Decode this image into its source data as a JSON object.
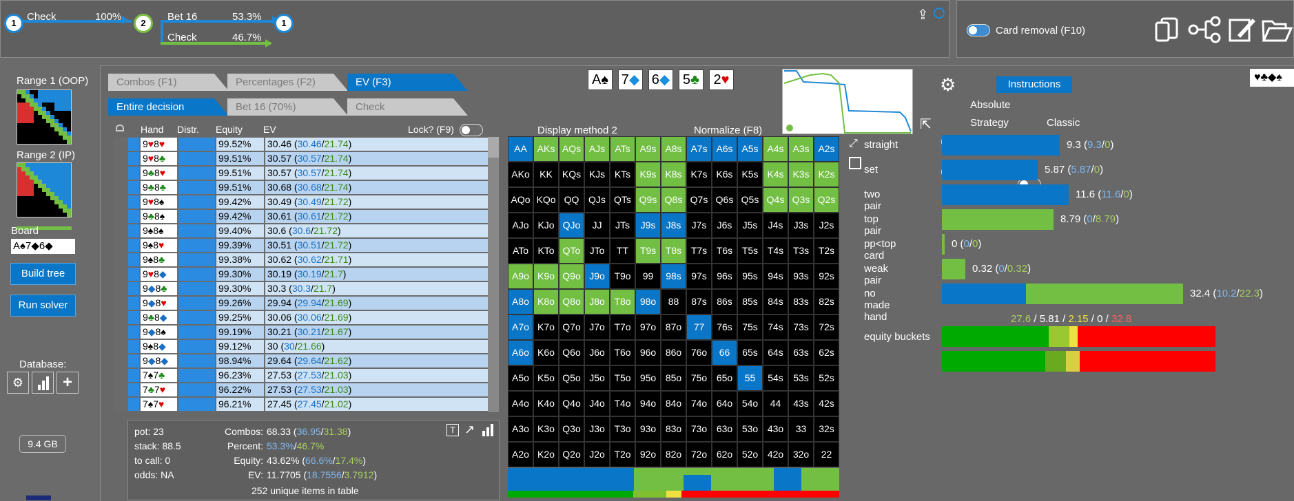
{
  "tree": {
    "node1": "1",
    "node2": "2",
    "node3": "1",
    "step1": {
      "label": "Check",
      "pct": "100%"
    },
    "step2a": {
      "label": "Bet 16",
      "pct": "53.3%"
    },
    "step2b": {
      "label": "Check",
      "pct": "46.7%"
    }
  },
  "top_right": {
    "card_removal": "Card removal (F10)"
  },
  "left": {
    "range1": "Range 1 (OOP)",
    "range2": "Range 2 (IP)",
    "board_label": "Board",
    "board_value": "A♠7◆6◆",
    "build_tree": "Build tree",
    "run_solver": "Run solver",
    "database": "Database:",
    "memory": "9.4 GB"
  },
  "tabs": {
    "combos": "Combos (F1)",
    "percentages": "Percentages (F2)",
    "ev": "EV (F3)",
    "entire": "Entire decision",
    "bet16": "Bet 16 (70%)",
    "check": "Check"
  },
  "table": {
    "headers": {
      "hand": "Hand",
      "distr": "Distr.",
      "equity": "Equity",
      "ev": "EV",
      "lock": "Lock? (F9)"
    },
    "rows": [
      {
        "r1": "9",
        "s1": "♥",
        "r2": "8",
        "s2": "♥",
        "eq": "99.52%",
        "ev": "30.46",
        "a": "30.46",
        "b": "21.74"
      },
      {
        "r1": "9",
        "s1": "♥",
        "r2": "8",
        "s2": "♣",
        "eq": "99.51%",
        "ev": "30.57",
        "a": "30.57",
        "b": "21.74"
      },
      {
        "r1": "9",
        "s1": "♣",
        "r2": "8",
        "s2": "♥",
        "eq": "99.51%",
        "ev": "30.57",
        "a": "30.57",
        "b": "21.74"
      },
      {
        "r1": "9",
        "s1": "♣",
        "r2": "8",
        "s2": "♣",
        "eq": "99.51%",
        "ev": "30.68",
        "a": "30.68",
        "b": "21.74"
      },
      {
        "r1": "9",
        "s1": "♥",
        "r2": "8",
        "s2": "♠",
        "eq": "99.42%",
        "ev": "30.49",
        "a": "30.49",
        "b": "21.72"
      },
      {
        "r1": "9",
        "s1": "♣",
        "r2": "8",
        "s2": "♠",
        "eq": "99.42%",
        "ev": "30.61",
        "a": "30.61",
        "b": "21.72"
      },
      {
        "r1": "9",
        "s1": "♠",
        "r2": "8",
        "s2": "♠",
        "eq": "99.40%",
        "ev": "30.6",
        "a": "30.6",
        "b": "21.72"
      },
      {
        "r1": "9",
        "s1": "♠",
        "r2": "8",
        "s2": "♥",
        "eq": "99.39%",
        "ev": "30.51",
        "a": "30.51",
        "b": "21.72"
      },
      {
        "r1": "9",
        "s1": "♠",
        "r2": "8",
        "s2": "♣",
        "eq": "99.38%",
        "ev": "30.62",
        "a": "30.62",
        "b": "21.71"
      },
      {
        "r1": "9",
        "s1": "♥",
        "r2": "8",
        "s2": "◆",
        "eq": "99.30%",
        "ev": "30.19",
        "a": "30.19",
        "b": "21.7"
      },
      {
        "r1": "9",
        "s1": "◆",
        "r2": "8",
        "s2": "♣",
        "eq": "99.30%",
        "ev": "30.3",
        "a": "30.3",
        "b": "21.7"
      },
      {
        "r1": "9",
        "s1": "◆",
        "r2": "8",
        "s2": "♥",
        "eq": "99.26%",
        "ev": "29.94",
        "a": "29.94",
        "b": "21.69"
      },
      {
        "r1": "9",
        "s1": "♣",
        "r2": "8",
        "s2": "◆",
        "eq": "99.25%",
        "ev": "30.06",
        "a": "30.06",
        "b": "21.69"
      },
      {
        "r1": "9",
        "s1": "◆",
        "r2": "8",
        "s2": "♠",
        "eq": "99.19%",
        "ev": "30.21",
        "a": "30.21",
        "b": "21.67"
      },
      {
        "r1": "9",
        "s1": "♠",
        "r2": "8",
        "s2": "◆",
        "eq": "99.12%",
        "ev": "30",
        "a": "30",
        "b": "21.66"
      },
      {
        "r1": "9",
        "s1": "◆",
        "r2": "8",
        "s2": "◆",
        "eq": "98.94%",
        "ev": "29.64",
        "a": "29.64",
        "b": "21.62"
      },
      {
        "r1": "7",
        "s1": "♠",
        "r2": "7",
        "s2": "♣",
        "eq": "96.23%",
        "ev": "27.53",
        "a": "27.53",
        "b": "21.03"
      },
      {
        "r1": "7",
        "s1": "♣",
        "r2": "7",
        "s2": "♥",
        "eq": "96.22%",
        "ev": "27.53",
        "a": "27.53",
        "b": "21.03"
      },
      {
        "r1": "7",
        "s1": "♠",
        "r2": "7",
        "s2": "♥",
        "eq": "96.21%",
        "ev": "27.45",
        "a": "27.45",
        "b": "21.02"
      }
    ]
  },
  "summary": {
    "pot": "pot: 23",
    "stack": "stack: 88.5",
    "tocall": "to call: 0",
    "odds": "odds: NA",
    "combos_lbl": "Combos:",
    "combos_val": "68.33",
    "combos_a": "36.95",
    "combos_b": "31.38",
    "percent_lbl": "Percent:",
    "percent_a": "53.3%",
    "percent_b": "46.7%",
    "equity_lbl": "Equity:",
    "equity_val": "43.62%",
    "equity_a": "66.6%",
    "equity_b": "17.4%",
    "ev_lbl": "EV:",
    "ev_val": "11.7705",
    "ev_a": "18.7556",
    "ev_b": "3.7912",
    "unique": "252 unique items in table"
  },
  "options": {
    "display_method": "Display method 2",
    "normalize": "Normalize (F8)",
    "instructions": "Instructions",
    "absolute": "Absolute",
    "strategy": "Strategy",
    "classic": "Classic"
  },
  "board_cards": [
    {
      "rank": "A",
      "suit": "♠",
      "color": "#000000"
    },
    {
      "rank": "7",
      "suit": "◆",
      "color": "#1a8fe0"
    },
    {
      "rank": "6",
      "suit": "◆",
      "color": "#1a8fe0"
    },
    {
      "rank": "5",
      "suit": "♣",
      "color": "#1b8a1b"
    },
    {
      "rank": "2",
      "suit": "♥",
      "color": "#dd0000"
    }
  ],
  "suit_icons": "♥♣◆♠",
  "hand_grid": [
    [
      "AA",
      "AKs",
      "AQs",
      "AJs",
      "ATs",
      "A9s",
      "A8s",
      "A7s",
      "A6s",
      "A5s",
      "A4s",
      "A3s",
      "A2s"
    ],
    [
      "AKo",
      "KK",
      "KQs",
      "KJs",
      "KTs",
      "K9s",
      "K8s",
      "K7s",
      "K6s",
      "K5s",
      "K4s",
      "K3s",
      "K2s"
    ],
    [
      "AQo",
      "KQo",
      "QQ",
      "QJs",
      "QTs",
      "Q9s",
      "Q8s",
      "Q7s",
      "Q6s",
      "Q5s",
      "Q4s",
      "Q3s",
      "Q2s"
    ],
    [
      "AJo",
      "KJo",
      "QJo",
      "JJ",
      "JTs",
      "J9s",
      "J8s",
      "J7s",
      "J6s",
      "J5s",
      "J4s",
      "J3s",
      "J2s"
    ],
    [
      "ATo",
      "KTo",
      "QTo",
      "JTo",
      "TT",
      "T9s",
      "T8s",
      "T7s",
      "T6s",
      "T5s",
      "T4s",
      "T3s",
      "T2s"
    ],
    [
      "A9o",
      "K9o",
      "Q9o",
      "J9o",
      "T9o",
      "99",
      "98s",
      "97s",
      "96s",
      "95s",
      "94s",
      "93s",
      "92s"
    ],
    [
      "A8o",
      "K8o",
      "Q8o",
      "J8o",
      "T8o",
      "98o",
      "88",
      "87s",
      "86s",
      "85s",
      "84s",
      "83s",
      "82s"
    ],
    [
      "A7o",
      "K7o",
      "Q7o",
      "J7o",
      "T7o",
      "97o",
      "87o",
      "77",
      "76s",
      "75s",
      "74s",
      "73s",
      "72s"
    ],
    [
      "A6o",
      "K6o",
      "Q6o",
      "J6o",
      "T6o",
      "96o",
      "86o",
      "76o",
      "66",
      "65s",
      "64s",
      "63s",
      "62s"
    ],
    [
      "A5o",
      "K5o",
      "Q5o",
      "J5o",
      "T5o",
      "95o",
      "85o",
      "75o",
      "65o",
      "55",
      "54s",
      "53s",
      "52s"
    ],
    [
      "A4o",
      "K4o",
      "Q4o",
      "J4o",
      "T4o",
      "94o",
      "84o",
      "74o",
      "64o",
      "54o",
      "44",
      "43s",
      "42s"
    ],
    [
      "A3o",
      "K3o",
      "Q3o",
      "J3o",
      "T3o",
      "93o",
      "83o",
      "73o",
      "63o",
      "53o",
      "43o",
      "33",
      "32s"
    ],
    [
      "A2o",
      "K2o",
      "Q2o",
      "J2o",
      "T2o",
      "92o",
      "82o",
      "72o",
      "62o",
      "52o",
      "42o",
      "32o",
      "22"
    ]
  ],
  "grid_colors": [
    [
      "b",
      "g",
      "g",
      "g",
      "g",
      "g",
      "g",
      "b",
      "b",
      "b",
      "g",
      "g",
      "b"
    ],
    [
      "k",
      "k",
      "k",
      "k",
      "k",
      "g",
      "g",
      "k",
      "k",
      "k",
      "g",
      "g",
      "g"
    ],
    [
      "k",
      "k",
      "k",
      "k",
      "k",
      "g",
      "g",
      "k",
      "k",
      "k",
      "g",
      "g",
      "g"
    ],
    [
      "k",
      "k",
      "b",
      "k",
      "k",
      "b",
      "b",
      "k",
      "k",
      "k",
      "k",
      "k",
      "k"
    ],
    [
      "k",
      "k",
      "g",
      "k",
      "k",
      "g",
      "g",
      "k",
      "k",
      "k",
      "k",
      "k",
      "k"
    ],
    [
      "g",
      "g",
      "g",
      "b",
      "k",
      "k",
      "b",
      "k",
      "k",
      "k",
      "k",
      "k",
      "k"
    ],
    [
      "b",
      "g",
      "g",
      "g",
      "g",
      "b",
      "k",
      "k",
      "k",
      "k",
      "k",
      "k",
      "k"
    ],
    [
      "b",
      "k",
      "k",
      "k",
      "k",
      "k",
      "k",
      "b",
      "k",
      "k",
      "k",
      "k",
      "k"
    ],
    [
      "b",
      "k",
      "k",
      "k",
      "k",
      "k",
      "k",
      "k",
      "b",
      "k",
      "k",
      "k",
      "k"
    ],
    [
      "k",
      "k",
      "k",
      "k",
      "k",
      "k",
      "k",
      "k",
      "k",
      "b",
      "k",
      "k",
      "k"
    ],
    [
      "k",
      "k",
      "k",
      "k",
      "k",
      "k",
      "k",
      "k",
      "k",
      "k",
      "k",
      "k",
      "k"
    ],
    [
      "k",
      "k",
      "k",
      "k",
      "k",
      "k",
      "k",
      "k",
      "k",
      "k",
      "k",
      "k",
      "k"
    ],
    [
      "k",
      "k",
      "k",
      "k",
      "k",
      "k",
      "k",
      "k",
      "k",
      "k",
      "k",
      "k",
      "k"
    ]
  ],
  "categories": [
    {
      "label": "straight",
      "val": "9.3",
      "a": "9.3",
      "b": "0",
      "blue": 0.9,
      "green": 0
    },
    {
      "label": "set",
      "val": "5.87",
      "a": "5.87",
      "b": "0",
      "blue": 0.73,
      "green": 0
    },
    {
      "label": "two pair",
      "val": "11.6",
      "a": "11.6",
      "b": "0",
      "blue": 0.97,
      "green": 0
    },
    {
      "label": "top pair",
      "val": "8.79",
      "a": "0",
      "b": "8.79",
      "blue": 0,
      "green": 0.85
    },
    {
      "label": "pp<top card",
      "val": "0",
      "a": "0",
      "b": "0",
      "blue": 0,
      "green": 0.01
    },
    {
      "label": "weak pair",
      "val": "0.32",
      "a": "0",
      "b": "0.32",
      "blue": 0,
      "green": 0.18
    },
    {
      "label": "no made hand",
      "val": "32.4",
      "a": "10.2",
      "b": "22.3",
      "blue": 0.35,
      "green": 0.65
    }
  ],
  "buckets": {
    "label": "equity buckets",
    "v1": "27.6",
    "v2": "5.81",
    "v3": "2.15",
    "v4": "0",
    "v5": "32.8",
    "c1": "#a8d05b",
    "c2": "#ffffff",
    "c3": "#f0e040",
    "c4": "#ffffff",
    "c5": "#ff6060"
  },
  "colors": {
    "blue": "#0a76c7",
    "green": "#72bf44",
    "accent": "#1e88d8"
  }
}
